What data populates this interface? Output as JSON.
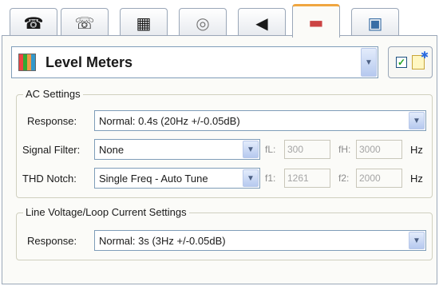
{
  "tabs": [
    {
      "icon": "telephone-icon",
      "glyph": "☎",
      "color": "#222222"
    },
    {
      "icon": "handset-icon",
      "glyph": "☏",
      "color": "#222222"
    },
    {
      "icon": "keypad-icon",
      "glyph": "▦",
      "color": "#222222"
    },
    {
      "icon": "dial-icon",
      "glyph": "◎",
      "color": "#666666"
    },
    {
      "icon": "speaker-icon",
      "glyph": "◀",
      "color": "#222222"
    },
    {
      "icon": "level-meter-icon",
      "glyph": "▬",
      "color": "#c44"
    },
    {
      "icon": "display-icon",
      "glyph": "▣",
      "color": "#3a6ea5"
    }
  ],
  "header": {
    "title": "Level Meters",
    "colors": {
      "accent_tab": "#f0a640",
      "checkbox_mark": "#21a121"
    }
  },
  "ac_settings": {
    "title": "AC Settings",
    "response_label": "Response:",
    "response_value": "Normal:  0.4s (20Hz +/-0.05dB)",
    "signal_filter_label": "Signal Filter:",
    "signal_filter_value": "None",
    "fl_label": "fL:",
    "fl_value": "300",
    "fh_label": "fH:",
    "fh_value": "3000",
    "filter_unit": "Hz",
    "thd_label": "THD Notch:",
    "thd_value": "Single Freq - Auto Tune",
    "f1_label": "f1:",
    "f1_value": "1261",
    "f2_label": "f2:",
    "f2_value": "2000",
    "thd_unit": "Hz"
  },
  "line_voltage": {
    "title": "Line Voltage/Loop Current Settings",
    "response_label": "Response:",
    "response_value": "Normal:  3s (3Hz +/-0.05dB)"
  }
}
